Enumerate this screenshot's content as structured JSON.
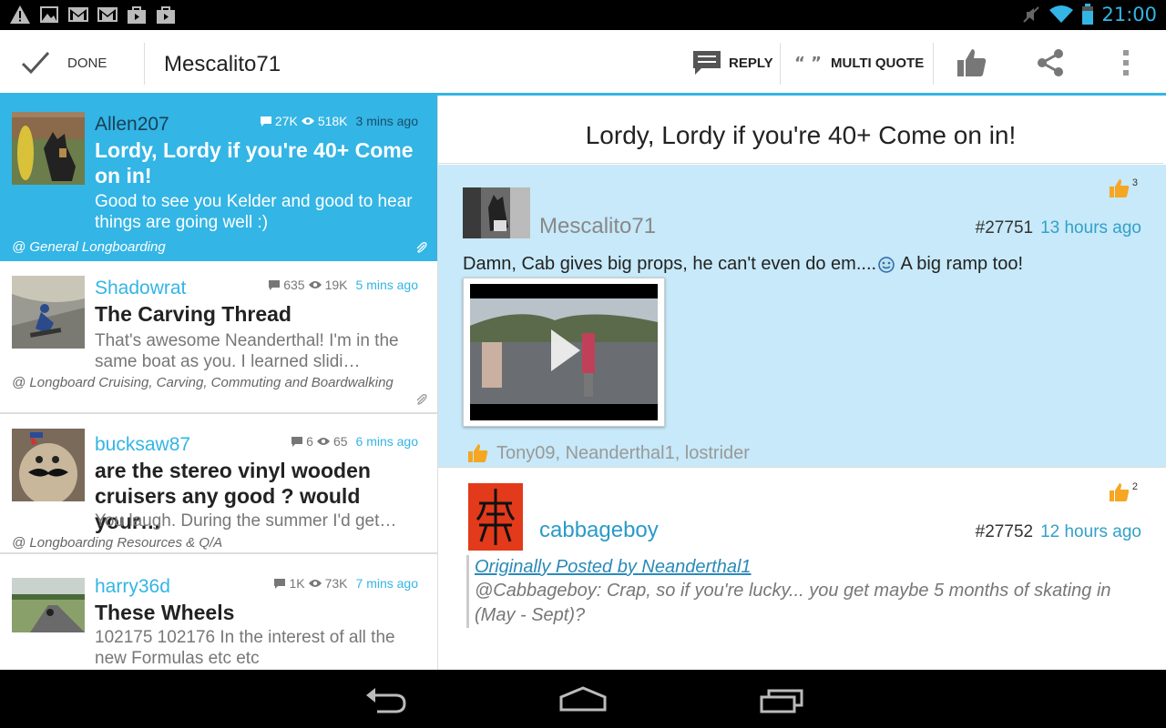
{
  "status_bar": {
    "time": "21:00"
  },
  "action_bar": {
    "done_label": "DONE",
    "title": "Mescalito71",
    "reply_label": "REPLY",
    "multi_quote_label": "MULTI QUOTE"
  },
  "threads": [
    {
      "author": "Allen207",
      "replies": "27K",
      "views": "518K",
      "time": "3 mins ago",
      "title": "Lordy, Lordy if you're 40+ Come on in!",
      "snippet": "Good to see you Kelder and good to hear things are going well :)",
      "forum": "@ General Longboarding"
    },
    {
      "author": "Shadowrat",
      "replies": "635",
      "views": "19K",
      "time": "5 mins ago",
      "title": "The Carving Thread",
      "snippet": "That's awesome Neanderthal! I'm in the same boat as you. I learned slidi…",
      "forum": "@ Longboard Cruising, Carving, Commuting and Boardwalking"
    },
    {
      "author": "bucksaw87",
      "replies": "6",
      "views": "65",
      "time": "6 mins ago",
      "title": "are the stereo vinyl wooden cruisers any good ? would your…",
      "snippet": "You laugh. During the summer I'd get…",
      "forum": "@ Longboarding Resources & Q/A"
    },
    {
      "author": "harry36d",
      "replies": "1K",
      "views": "73K",
      "time": "7 mins ago",
      "title": "These Wheels",
      "snippet": "102175 102176 In the interest of all the new Formulas etc etc",
      "forum": ""
    }
  ],
  "detail": {
    "title": "Lordy, Lordy if you're 40+ Come on in!",
    "posts": [
      {
        "author": "Mescalito71",
        "number": "#27751",
        "time": "13 hours ago",
        "likes": "3",
        "body_before": "Damn, Cab gives big props, he can't even do em....",
        "body_after": " A big ramp too!",
        "likers": "Tony09, Neanderthal1, lostrider"
      },
      {
        "author": "cabbageboy",
        "number": "#27752",
        "time": "12 hours ago",
        "likes": "2",
        "quote_link": "Originally Posted by Neanderthal1",
        "quote_text": "@Cabbageboy: Crap, so if you're lucky... you get maybe 5 months of skating in (May - Sept)?"
      }
    ]
  },
  "colors": {
    "accent": "#33b5e5",
    "selected_bg": "#33b5e5",
    "post_highlight_bg": "#c7e9f9",
    "like_orange": "#f5a623"
  }
}
